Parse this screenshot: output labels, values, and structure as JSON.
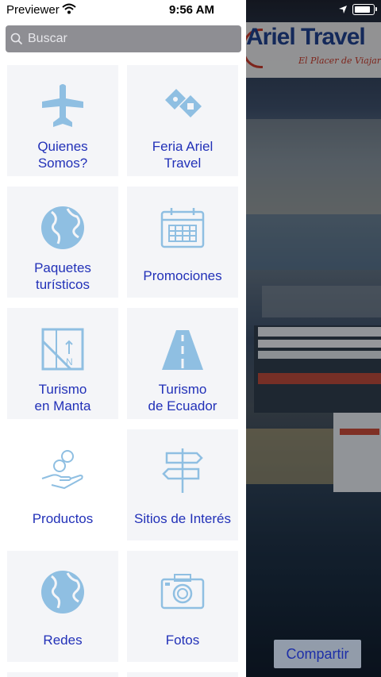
{
  "status_bar": {
    "carrier": "Previewer",
    "time": "9:56 AM"
  },
  "search": {
    "placeholder": "Buscar"
  },
  "menu": {
    "items": [
      {
        "label": "Quienes\nSomos?",
        "icon": "airplane-icon"
      },
      {
        "label": "Feria Ariel\nTravel",
        "icon": "tickets-icon"
      },
      {
        "label": "Paquetes\nturísticos",
        "icon": "globe-icon"
      },
      {
        "label": "Promociones",
        "icon": "calendar-icon"
      },
      {
        "label": "Turismo\nen Manta",
        "icon": "map-icon"
      },
      {
        "label": "Turismo\nde Ecuador",
        "icon": "road-icon"
      },
      {
        "label": "Productos",
        "icon": "hand-coins-icon"
      },
      {
        "label": "Sitios de Interés",
        "icon": "signpost-icon"
      },
      {
        "label": "Redes",
        "icon": "globe-icon"
      },
      {
        "label": "Fotos",
        "icon": "camera-icon"
      }
    ]
  },
  "brand": {
    "name": "Ariel Travel",
    "tagline": "El Placer de Viajar"
  },
  "share_button": {
    "label": "Compartir"
  },
  "colors": {
    "accent": "#2231b8",
    "icon": "#8fbfe2",
    "tile": "#f4f5f8"
  }
}
